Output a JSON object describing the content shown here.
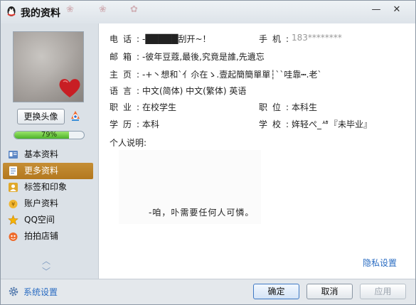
{
  "window": {
    "title": "我的资料"
  },
  "sidebar": {
    "change_avatar_label": "更换头像",
    "completion_text": "79%",
    "completion_fraction": 0.79,
    "items": [
      {
        "label": "基本资料",
        "icon": "profile-card-icon",
        "active": false
      },
      {
        "label": "更多资料",
        "icon": "more-info-icon",
        "active": true
      },
      {
        "label": "标签和印象",
        "icon": "tags-icon",
        "active": false
      },
      {
        "label": "账户资料",
        "icon": "account-icon",
        "active": false
      },
      {
        "label": "QQ空间",
        "icon": "qzone-star-icon",
        "active": false
      },
      {
        "label": "拍拍店铺",
        "icon": "shop-icon",
        "active": false
      }
    ]
  },
  "profile": {
    "phone_label": "电话:",
    "phone_value": "-█████刮开~！",
    "mobile_label": "手机:",
    "mobile_prefix": "183",
    "mobile_mask": "********",
    "email_label": "邮箱:",
    "email_value": "-彼年豆蔻,最後,究竟是誰,先遺忘",
    "homepage_label": "主页:",
    "homepage_value": "-+丶想和`亻尒在ゝ.壹起簡簡單單┆``哇靠┅.老`",
    "language_label": "语言:",
    "language_value": "中文(简体)  中文(繁体)  英语",
    "job_label": "职业:",
    "job_value": "在校学生",
    "position_label": "职位:",
    "position_value": "本科生",
    "education_label": "学历:",
    "education_value": "本科",
    "school_label": "学校:",
    "school_value": "姩轻ぺ_ᄻ『未毕业』",
    "intro_label": "个人说明:",
    "intro_text": "-咱，卟需要任何人可憐。",
    "privacy_label": "隐私设置"
  },
  "footer": {
    "settings_label": "系统设置",
    "ok_label": "确定",
    "cancel_label": "取消",
    "apply_label": "应用"
  },
  "colors": {
    "accent": "#c58e36",
    "link": "#2a6cc2",
    "progress": "#4cb32a"
  }
}
